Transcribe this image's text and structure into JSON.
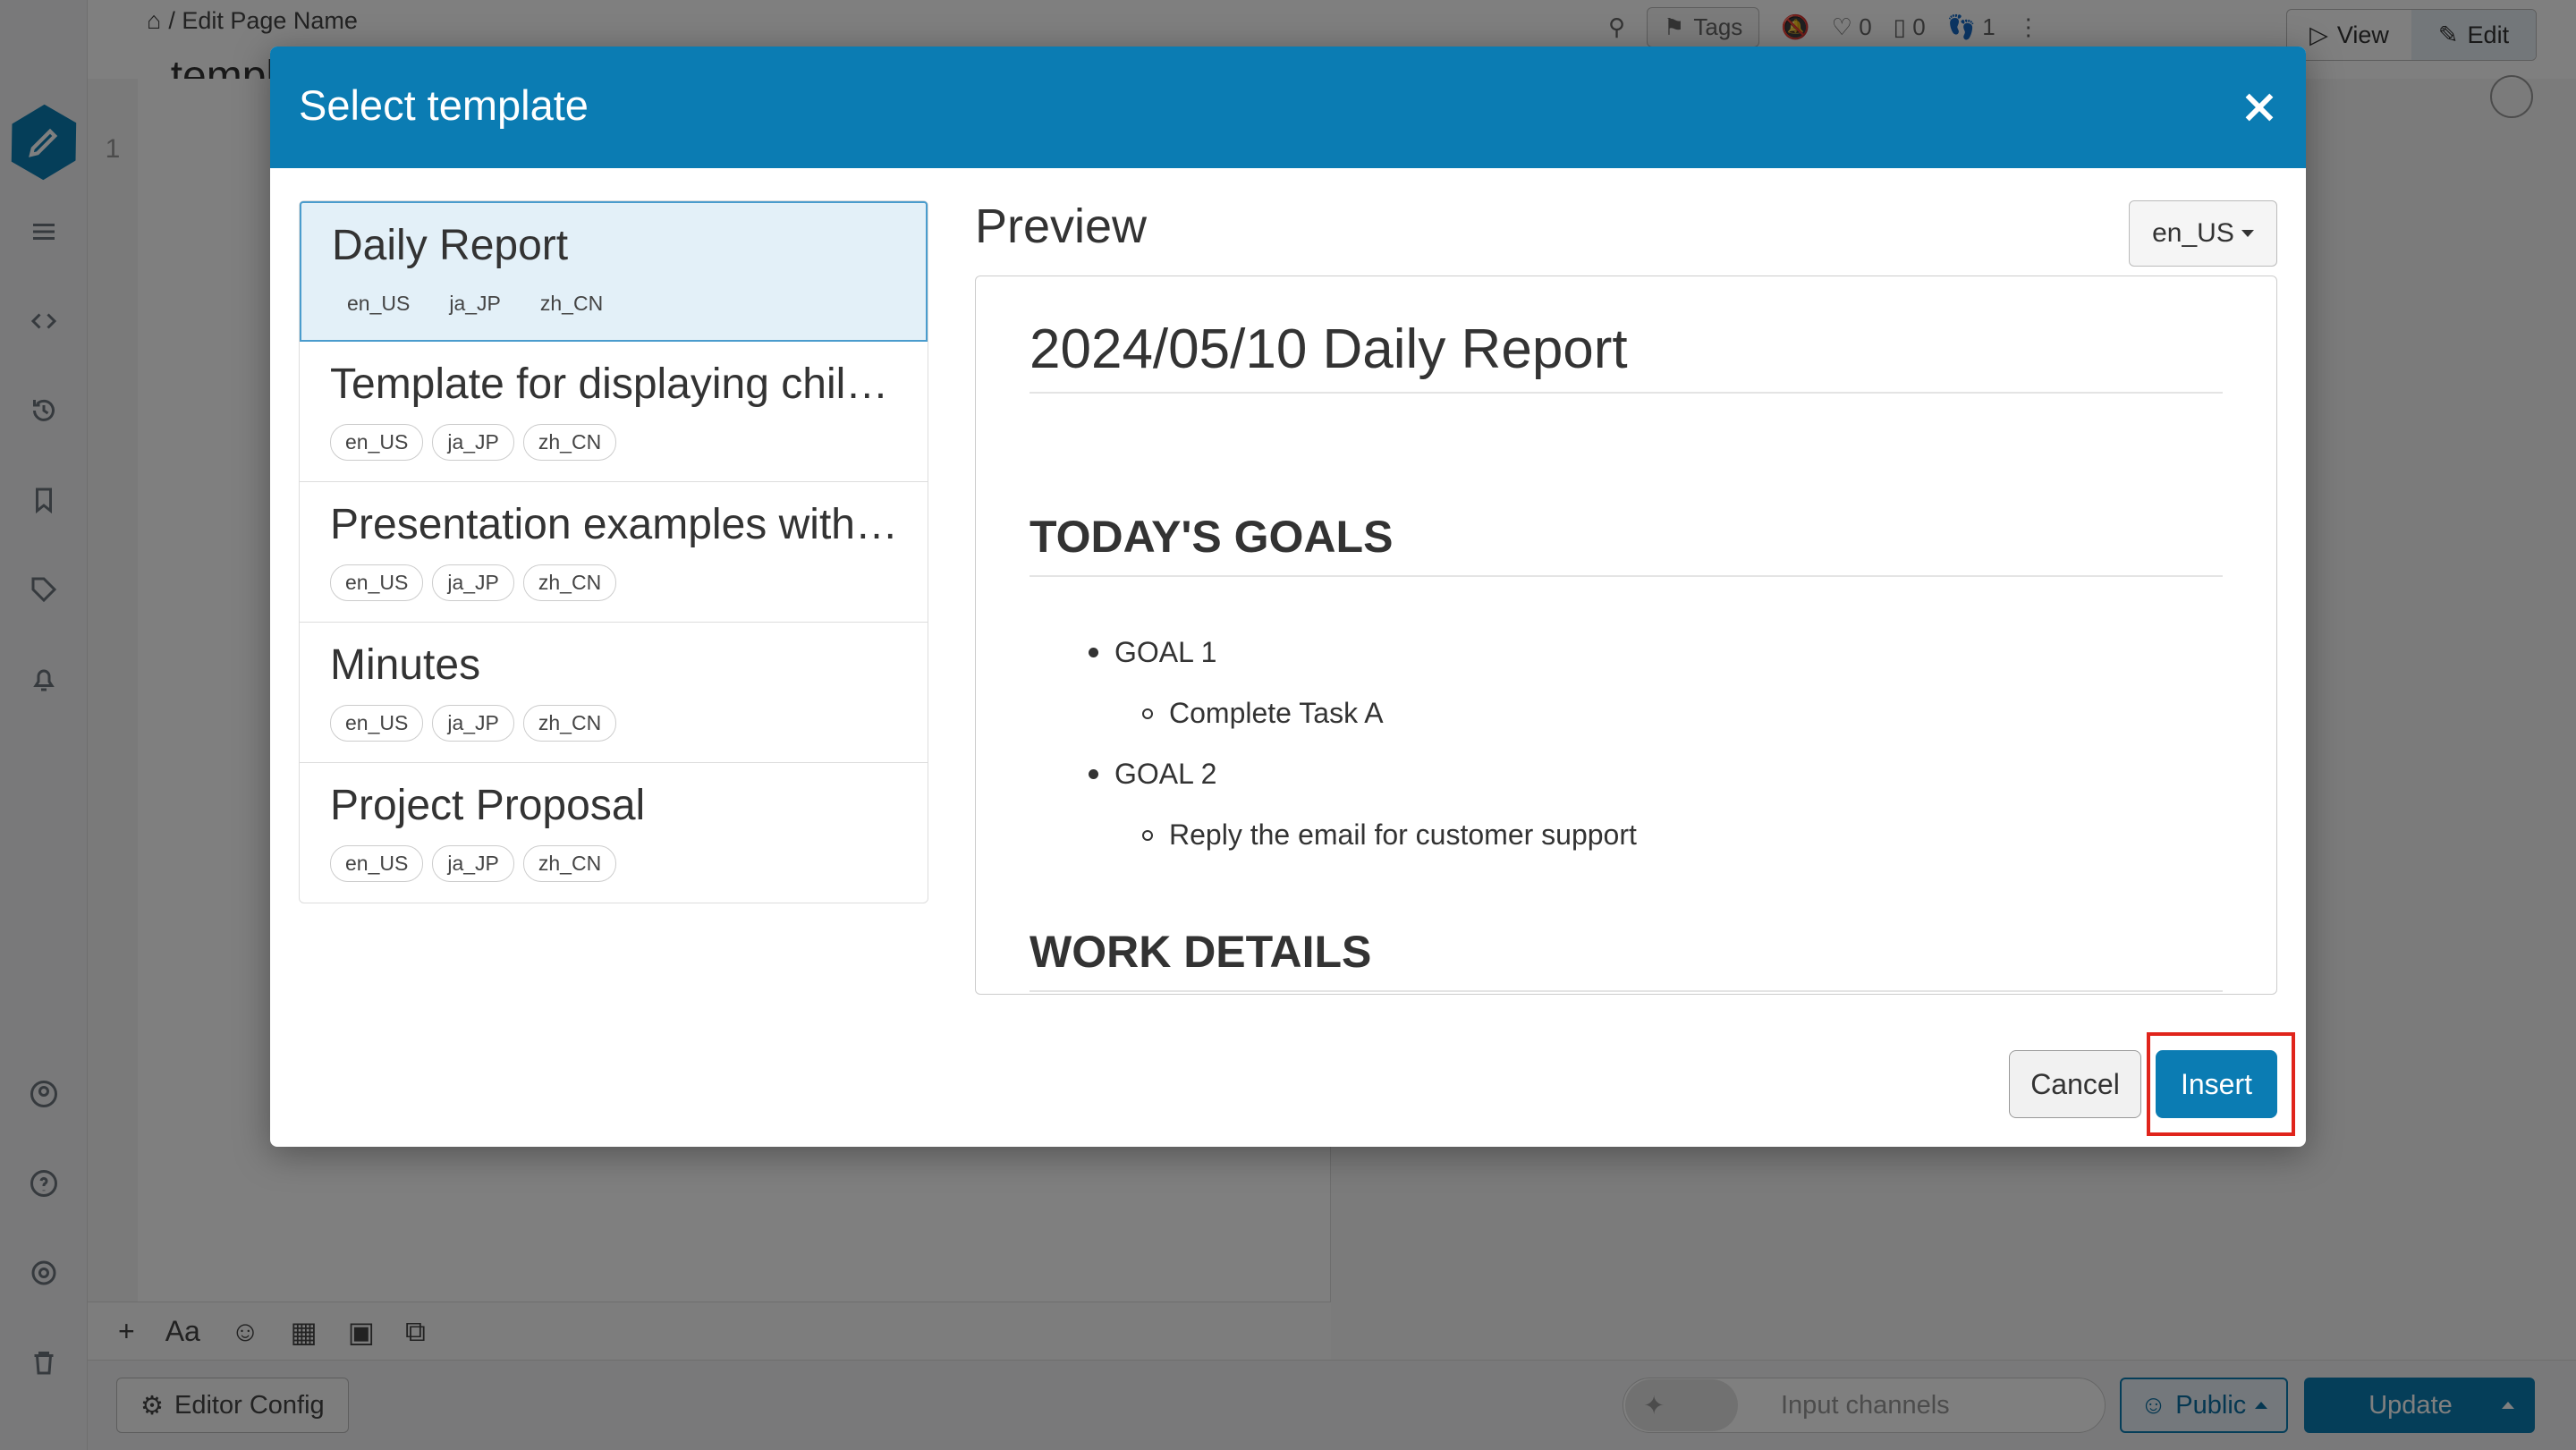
{
  "breadcrumb": {
    "path": "/ Edit Page Name"
  },
  "page": {
    "title": "_templ"
  },
  "editor": {
    "line_number": "1"
  },
  "topbar": {
    "tags_label": "Tags",
    "likes_count": "0",
    "bookmarks_count": "0",
    "seen_count": "1",
    "view_label": "View",
    "edit_label": "Edit"
  },
  "editor_toolbar": {
    "font_label": "Aa"
  },
  "bottombar": {
    "editor_config_label": "Editor Config",
    "channels_placeholder": "Input channels",
    "public_label": "Public",
    "update_label": "Update"
  },
  "modal": {
    "title": "Select template",
    "preview_title": "Preview",
    "locale": "en_US",
    "templates": [
      {
        "name": "Daily Report",
        "langs": [
          "en_US",
          "ja_JP",
          "zh_CN"
        ]
      },
      {
        "name": "Template for displaying child...",
        "langs": [
          "en_US",
          "ja_JP",
          "zh_CN"
        ]
      },
      {
        "name": "Presentation examples with ...",
        "langs": [
          "en_US",
          "ja_JP",
          "zh_CN"
        ]
      },
      {
        "name": "Minutes",
        "langs": [
          "en_US",
          "ja_JP",
          "zh_CN"
        ]
      },
      {
        "name": "Project Proposal",
        "langs": [
          "en_US",
          "ja_JP",
          "zh_CN"
        ]
      }
    ],
    "preview": {
      "h1": "2024/05/10 Daily Report",
      "h2_goals": "TODAY'S GOALS",
      "goal1": "GOAL 1",
      "task_a": "Complete Task A",
      "goal2": "GOAL 2",
      "task_b": "Reply the email for customer support",
      "h2_work": "WORK DETAILS"
    },
    "cancel_label": "Cancel",
    "insert_label": "Insert"
  },
  "colors": {
    "primary": "#0b7cb3",
    "highlight": "#e0241b",
    "selected_item_bg": "#e3f0f8"
  }
}
